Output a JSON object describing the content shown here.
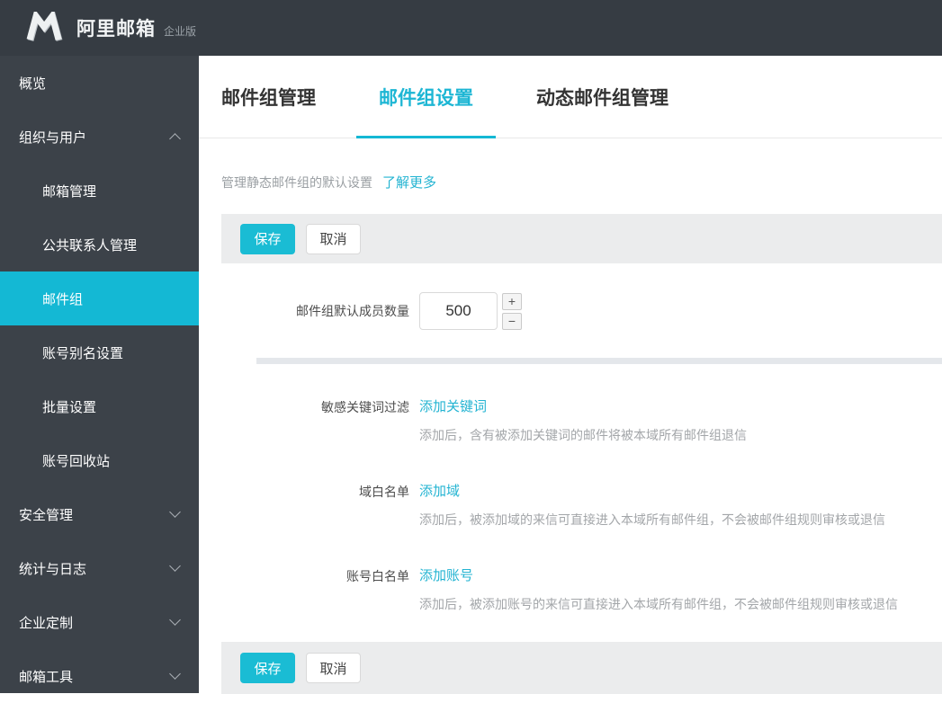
{
  "brand": {
    "name": "阿里邮箱",
    "edition": "企业版",
    "logo_icon": "alimail-m-logo"
  },
  "colors": {
    "accent_cyan": "#14b8d4",
    "header_bg": "#363c43",
    "sidebar_bg": "#3c4249",
    "link_cyan": "#24b4d2",
    "bar_gray": "#ebeced"
  },
  "sidebar": {
    "items": [
      {
        "label": "概览",
        "sub": false,
        "active": false,
        "chevron": null
      },
      {
        "label": "组织与用户",
        "sub": false,
        "active": false,
        "chevron": "up"
      },
      {
        "label": "邮箱管理",
        "sub": true,
        "active": false,
        "chevron": null
      },
      {
        "label": "公共联系人管理",
        "sub": true,
        "active": false,
        "chevron": null
      },
      {
        "label": "邮件组",
        "sub": true,
        "active": true,
        "chevron": null
      },
      {
        "label": "账号别名设置",
        "sub": true,
        "active": false,
        "chevron": null
      },
      {
        "label": "批量设置",
        "sub": true,
        "active": false,
        "chevron": null
      },
      {
        "label": "账号回收站",
        "sub": true,
        "active": false,
        "chevron": null
      },
      {
        "label": "安全管理",
        "sub": false,
        "active": false,
        "chevron": "down"
      },
      {
        "label": "统计与日志",
        "sub": false,
        "active": false,
        "chevron": "down"
      },
      {
        "label": "企业定制",
        "sub": false,
        "active": false,
        "chevron": "down"
      },
      {
        "label": "邮箱工具",
        "sub": false,
        "active": false,
        "chevron": "down"
      }
    ]
  },
  "tabs": [
    {
      "label": "邮件组管理",
      "active": false
    },
    {
      "label": "邮件组设置",
      "active": true
    },
    {
      "label": "动态邮件组管理",
      "active": false
    }
  ],
  "page": {
    "description": "管理静态邮件组的默认设置",
    "learn_more_label": "了解更多",
    "save_label": "保存",
    "cancel_label": "取消",
    "member_count": {
      "label": "邮件组默认成员数量",
      "value": "500",
      "increase_label": "+",
      "decrease_label": "−"
    },
    "settings": [
      {
        "label": "敏感关键词过滤",
        "link_label": "添加关键词",
        "description": "添加后，含有被添加关键词的邮件将被本域所有邮件组退信"
      },
      {
        "label": "域白名单",
        "link_label": "添加域",
        "description": "添加后，被添加域的来信可直接进入本域所有邮件组，不会被邮件组规则审核或退信"
      },
      {
        "label": "账号白名单",
        "link_label": "添加账号",
        "description": "添加后，被添加账号的来信可直接进入本域所有邮件组，不会被邮件组规则审核或退信"
      }
    ]
  }
}
